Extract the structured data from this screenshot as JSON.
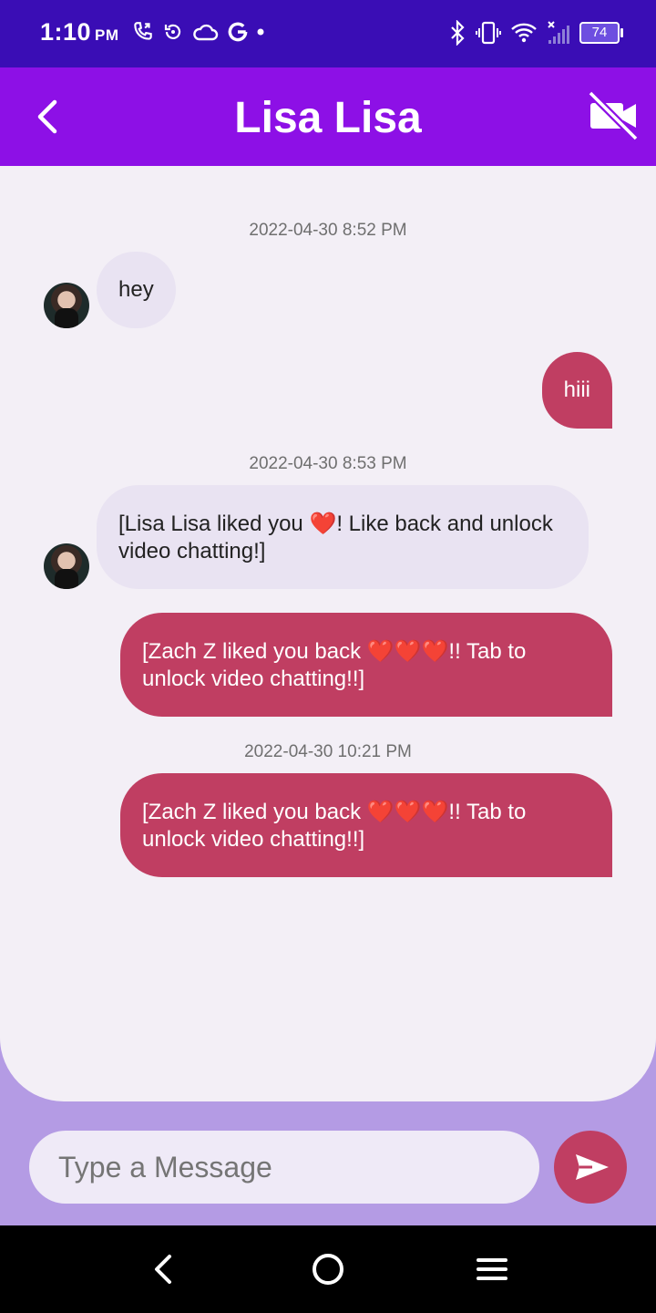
{
  "status": {
    "time": "1:10",
    "ampm": "PM",
    "battery": "74"
  },
  "header": {
    "title": "Lisa Lisa"
  },
  "messages": [
    {
      "type": "timestamp",
      "text": "2022-04-30 8:52 PM"
    },
    {
      "type": "incoming",
      "text": "hey"
    },
    {
      "type": "outgoing",
      "text": "hiii"
    },
    {
      "type": "timestamp",
      "text": "2022-04-30 8:53 PM"
    },
    {
      "type": "incoming",
      "text": "[Lisa Lisa liked you ❤️! Like back and unlock video chatting!]"
    },
    {
      "type": "outgoing",
      "text": "[Zach Z liked you back ❤️❤️❤️!! Tab to unlock video chatting!!]"
    },
    {
      "type": "timestamp",
      "text": "2022-04-30 10:21 PM"
    },
    {
      "type": "outgoing",
      "text": "[Zach Z liked you back ❤️❤️❤️!! Tab to unlock video chatting!!]"
    }
  ],
  "composer": {
    "placeholder": "Type a Message"
  },
  "colors": {
    "status_bar": "#3a0db5",
    "header": "#8d10e6",
    "outgoing_bubble": "#c03e62",
    "incoming_bubble": "#e9e3f2",
    "chat_bg": "#f3eff6",
    "footer_bg": "#b49be4"
  },
  "icons": [
    "phone-call-icon",
    "sync-icon",
    "cloud-icon",
    "google-icon",
    "bluetooth-icon",
    "vibrate-icon",
    "wifi-icon",
    "signal-icon",
    "battery-icon",
    "back-arrow-icon",
    "video-off-icon",
    "send-icon",
    "nav-back-icon",
    "nav-home-icon",
    "nav-menu-icon"
  ]
}
